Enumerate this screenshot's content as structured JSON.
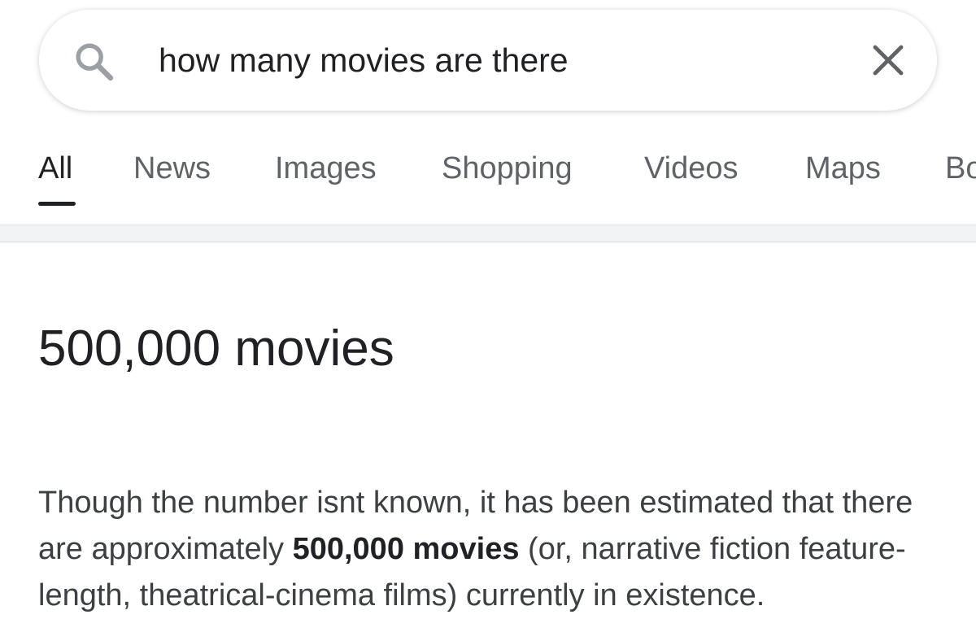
{
  "search": {
    "query": "how many movies are there"
  },
  "tabs": [
    {
      "label": "All"
    },
    {
      "label": "News"
    },
    {
      "label": "Images"
    },
    {
      "label": "Shopping"
    },
    {
      "label": "Videos"
    },
    {
      "label": "Maps"
    },
    {
      "label": "Books"
    }
  ],
  "answer": {
    "title": "500,000 movies",
    "snippet_before": "Though the number isnt known, it has been estimated that there are approximately ",
    "snippet_bold": "500,000 movies",
    "snippet_after": " (or, narrative fiction feature-length, theatrical-cinema films) currently in existence."
  },
  "colors": {
    "text_primary": "#202124",
    "text_secondary": "#5f6368",
    "divider": "#f1f3f4"
  },
  "icons": {
    "search": "search-icon",
    "clear": "close-icon"
  }
}
